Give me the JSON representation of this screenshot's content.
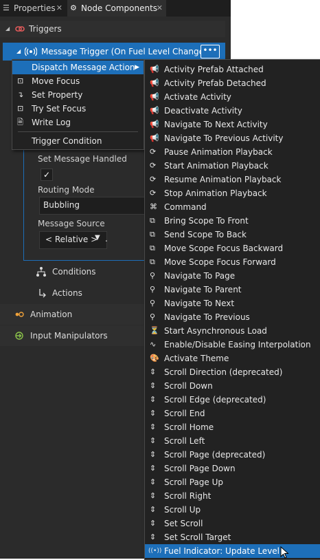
{
  "tabs": [
    {
      "label": "Properties",
      "icon": "properties-icon",
      "close": "✕"
    },
    {
      "label": "Node Components",
      "icon": "node-components-icon",
      "close": "✕"
    }
  ],
  "triggers": {
    "label": "Triggers",
    "icon": "triggers-icon"
  },
  "trigger_item": {
    "label": "Message Trigger (On Fuel Level Changed)",
    "icon": "message-trigger-icon",
    "more": "•••"
  },
  "properties": {
    "set_message_handled": {
      "label": "Set Message Handled",
      "checked": "✓"
    },
    "routing_mode": {
      "label": "Routing Mode",
      "value": "Bubbling"
    },
    "message_source": {
      "label": "Message Source",
      "value": "< Relative >",
      "arrow": "▼",
      "path": "."
    }
  },
  "conditions": {
    "label": "Conditions",
    "icon": "conditions-icon"
  },
  "actions": {
    "label": "Actions",
    "icon": "actions-icon"
  },
  "animation": {
    "label": "Animation",
    "icon": "animation-icon"
  },
  "input_manipulators": {
    "label": "Input Manipulators",
    "icon": "input-manipulators-icon"
  },
  "menu_primary": {
    "items": [
      {
        "label": "Dispatch Message Action",
        "icon": "",
        "submenu_arrow": "▶",
        "selected": true
      },
      {
        "label": "Move Focus",
        "icon": "focus-icon"
      },
      {
        "label": "Set Property",
        "icon": "set-property-icon"
      },
      {
        "label": "Try Set Focus",
        "icon": "focus-icon"
      },
      {
        "label": "Write Log",
        "icon": "log-icon"
      }
    ],
    "footer": {
      "label": "Trigger Condition"
    }
  },
  "menu_secondary": {
    "items": [
      {
        "label": "Activity Prefab Attached",
        "icon": "message-icon"
      },
      {
        "label": "Activity Prefab Detached",
        "icon": "message-icon"
      },
      {
        "label": "Activate Activity",
        "icon": "message-icon"
      },
      {
        "label": "Deactivate Activity",
        "icon": "message-icon"
      },
      {
        "label": "Navigate To Next Activity",
        "icon": "message-icon"
      },
      {
        "label": "Navigate To Previous Activity",
        "icon": "message-icon"
      },
      {
        "label": "Pause Animation Playback",
        "icon": "animation-playback-icon"
      },
      {
        "label": "Start Animation Playback",
        "icon": "animation-playback-icon"
      },
      {
        "label": "Resume Animation Playback",
        "icon": "animation-playback-icon"
      },
      {
        "label": "Stop Animation Playback",
        "icon": "animation-playback-icon"
      },
      {
        "label": "Command",
        "icon": "command-icon"
      },
      {
        "label": "Bring Scope To Front",
        "icon": "scope-icon"
      },
      {
        "label": "Send Scope To Back",
        "icon": "scope-icon"
      },
      {
        "label": "Move Scope Focus Backward",
        "icon": "scope-icon"
      },
      {
        "label": "Move Scope Focus Forward",
        "icon": "scope-icon"
      },
      {
        "label": "Navigate To Page",
        "icon": "navigate-icon"
      },
      {
        "label": "Navigate To Parent",
        "icon": "navigate-icon"
      },
      {
        "label": "Navigate To Next",
        "icon": "navigate-icon"
      },
      {
        "label": "Navigate To Previous",
        "icon": "navigate-icon"
      },
      {
        "label": "Start Asynchronous Load",
        "icon": "load-icon"
      },
      {
        "label": "Enable/Disable Easing Interpolation",
        "icon": "easing-icon"
      },
      {
        "label": "Activate Theme",
        "icon": "theme-icon"
      },
      {
        "label": "Scroll Direction (deprecated)",
        "icon": "scroll-icon"
      },
      {
        "label": "Scroll Down",
        "icon": "scroll-icon"
      },
      {
        "label": "Scroll Edge (deprecated)",
        "icon": "scroll-icon"
      },
      {
        "label": "Scroll End",
        "icon": "scroll-icon"
      },
      {
        "label": "Scroll Home",
        "icon": "scroll-icon"
      },
      {
        "label": "Scroll Left",
        "icon": "scroll-icon"
      },
      {
        "label": "Scroll Page (deprecated)",
        "icon": "scroll-icon"
      },
      {
        "label": "Scroll Page Down",
        "icon": "scroll-icon"
      },
      {
        "label": "Scroll Page Up",
        "icon": "scroll-icon"
      },
      {
        "label": "Scroll Right",
        "icon": "scroll-icon"
      },
      {
        "label": "Scroll Up",
        "icon": "scroll-icon"
      },
      {
        "label": "Set Scroll",
        "icon": "scroll-icon"
      },
      {
        "label": "Set Scroll Target",
        "icon": "scroll-icon"
      },
      {
        "label": "Fuel Indicator: Update Level",
        "icon": "message-trigger-icon",
        "selected": true
      }
    ]
  },
  "colors": {
    "accent": "#1d6fb9",
    "panel": "#2b2b2b",
    "menu": "#222222"
  }
}
